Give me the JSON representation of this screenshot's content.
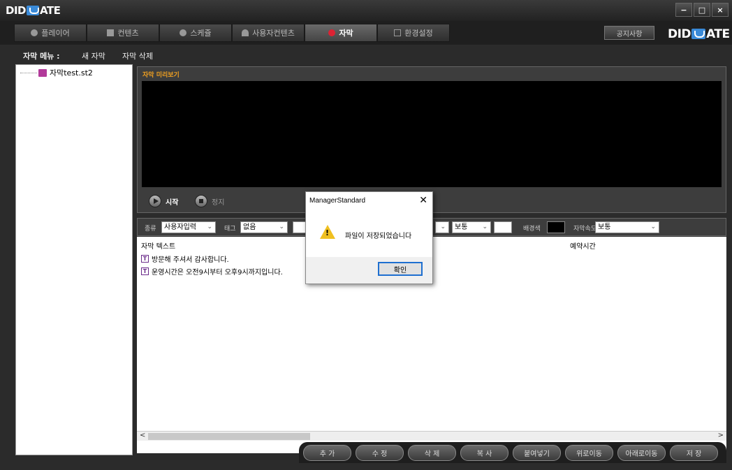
{
  "window": {
    "logo_left": "DID",
    "logo_right": "ATE",
    "minimize": "−",
    "maximize": "□",
    "close": "×"
  },
  "tabs": [
    {
      "label": "플레이어",
      "icon": "play-circle-icon"
    },
    {
      "label": "컨텐츠",
      "icon": "content-icon"
    },
    {
      "label": "스케쥴",
      "icon": "clock-icon"
    },
    {
      "label": "사용자컨텐츠",
      "icon": "user-icon"
    },
    {
      "label": "자막",
      "icon": "question-icon",
      "active": true
    },
    {
      "label": "환경설정",
      "icon": "settings-tv-icon"
    }
  ],
  "notice_button": "공지사항",
  "menu": {
    "label": "자막 메뉴 :",
    "new": "새 자막",
    "delete": "자막 삭제"
  },
  "tree": {
    "file": "자막test.st2"
  },
  "preview": {
    "title": "자막 미리보기",
    "start": "시작",
    "stop": "정지"
  },
  "options": {
    "kind_label": "종류",
    "kind_value": "사용자입력",
    "tag_label": "태그",
    "tag_value": "없음",
    "size_value": "보통",
    "bg_label": "배경색",
    "speed_label": "자막속도",
    "speed_value": "보통",
    "text_color": "#ffffff",
    "bg_color": "#000000"
  },
  "grid": {
    "col_text": "자막 텍스트",
    "col_time": "예약시간",
    "rows": [
      "방문해 주셔서 감사합니다.",
      "운영시간은 오전9시부터 오후9시까지입니다."
    ]
  },
  "buttons": [
    "추 가",
    "수 정",
    "삭 제",
    "복 사",
    "붙여넣기",
    "위로이동",
    "아래로이동",
    "저 장"
  ],
  "dialog": {
    "title": "ManagerStandard",
    "message": "파일이 저장되었습니다",
    "ok": "확인",
    "close": "✕"
  }
}
